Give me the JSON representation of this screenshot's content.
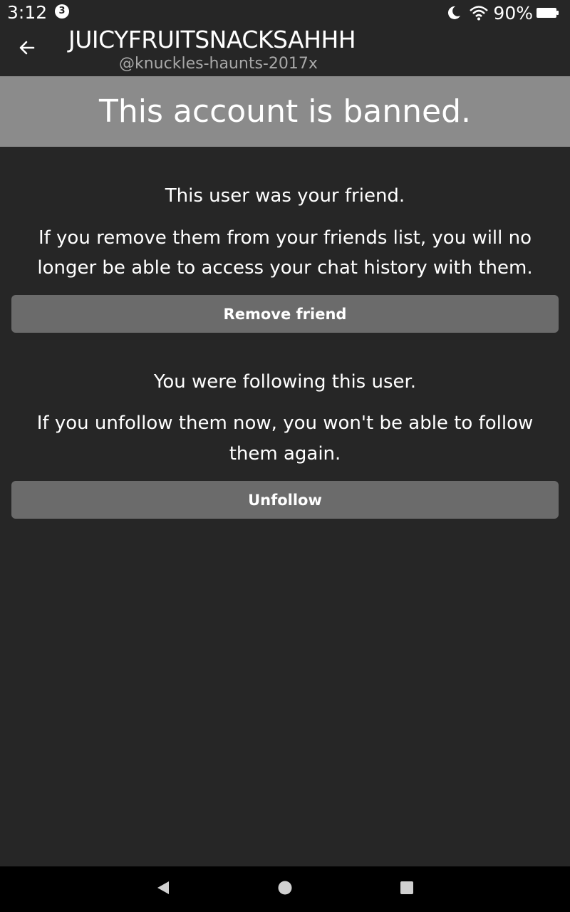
{
  "status_bar": {
    "time": "3:12",
    "notification_count": "3",
    "battery_percent": "90%",
    "icons": [
      "moon-icon",
      "wifi-icon",
      "battery-icon"
    ]
  },
  "header": {
    "back_icon": "arrow-left-icon",
    "display_name": "JUICYFRUITSNACKSAHHH",
    "username": "@knuckles-haunts-2017x"
  },
  "banner": {
    "title": "This account is banned."
  },
  "friend_section": {
    "heading": "This user was your friend.",
    "warning_line1": "If you remove them from your friends list, you will no",
    "warning_line2": "longer be able to access your chat history with them.",
    "button_label": "Remove friend"
  },
  "follow_section": {
    "heading": "You were following this user.",
    "warning_line1": "If you unfollow them now, you won't be able to follow",
    "warning_line2": "them again.",
    "button_label": "Unfollow"
  },
  "nav_bar": {
    "icons": [
      "back-triangle-icon",
      "home-circle-icon",
      "recents-square-icon"
    ]
  },
  "colors": {
    "background": "#262626",
    "banner": "#8b8b8b",
    "button": "#6b6b6b",
    "nav_bar": "#000000",
    "handle_text": "#a8a8a8"
  }
}
